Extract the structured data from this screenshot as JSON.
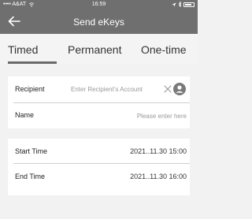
{
  "status_bar": {
    "carrier": "•••• A&AT",
    "time": "16:59"
  },
  "nav": {
    "title": "Send eKeys",
    "back_icon": "arrow-left-icon"
  },
  "tabs": [
    {
      "label": "Timed",
      "selected": true
    },
    {
      "label": "Permanent",
      "selected": false
    },
    {
      "label": "One-time",
      "selected": false
    }
  ],
  "form": {
    "recipient": {
      "label": "Recipient",
      "placeholder": "Enter Recipient’s Account",
      "value": ""
    },
    "name": {
      "label": "Name",
      "placeholder": "Please enter here",
      "value": ""
    }
  },
  "times": {
    "start": {
      "label": "Start Time",
      "value": "2021..11.30 15:00"
    },
    "end": {
      "label": "End Time",
      "value": "2021..11.30 16:00"
    }
  },
  "colors": {
    "header_bg": "#6f6f6f",
    "page_bg": "#f2f2f2",
    "card_bg": "#ffffff",
    "accent": "#6a6a6a"
  }
}
